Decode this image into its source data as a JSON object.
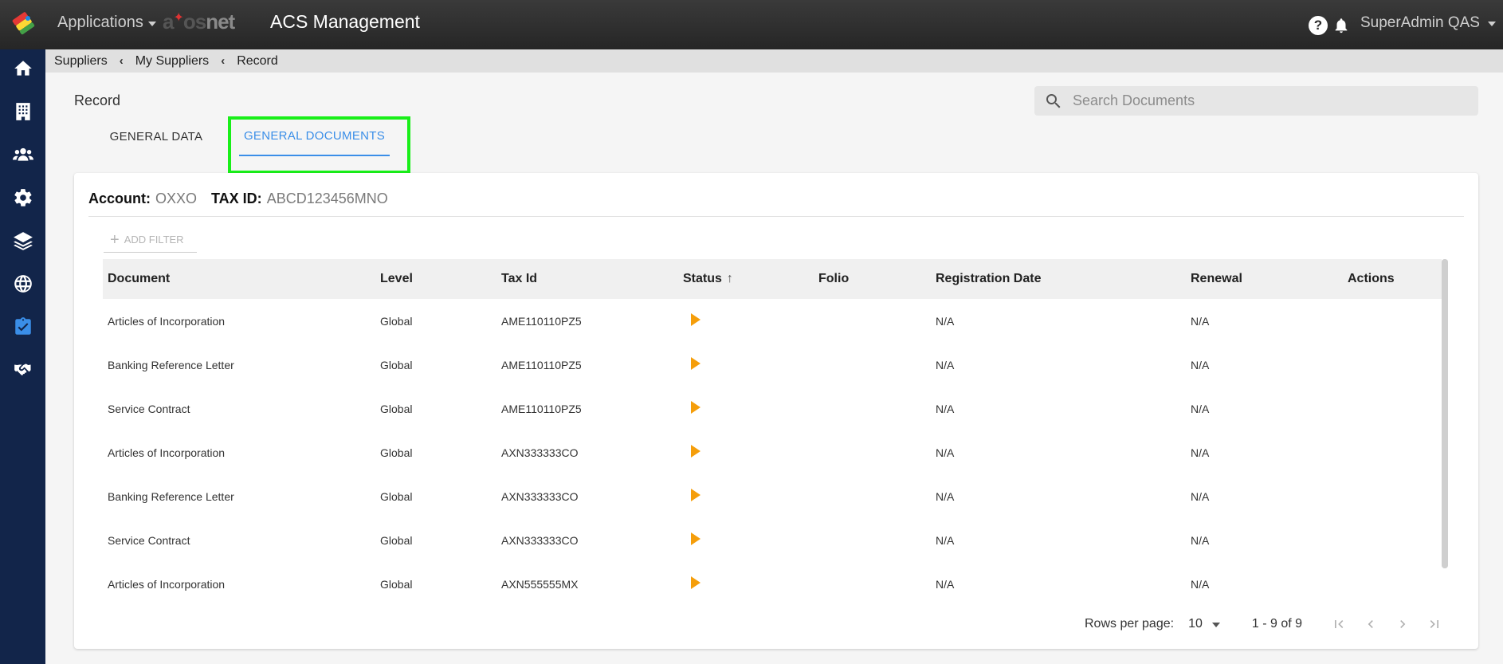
{
  "topbar": {
    "apps_label": "Applications",
    "brand_logo": "aXosnet",
    "app_title": "ACS Management",
    "user_name": "SuperAdmin QAS"
  },
  "sidebar": {
    "items": [
      {
        "icon": "home-icon"
      },
      {
        "icon": "building-icon"
      },
      {
        "icon": "users-icon"
      },
      {
        "icon": "gear-icon"
      },
      {
        "icon": "layers-icon"
      },
      {
        "icon": "globe-icon"
      },
      {
        "icon": "clipboard-check-icon",
        "active": true
      },
      {
        "icon": "handshake-icon"
      }
    ]
  },
  "breadcrumb": [
    "Suppliers",
    "My Suppliers",
    "Record"
  ],
  "page": {
    "title": "Record",
    "search_placeholder": "Search Documents"
  },
  "tabs": [
    "GENERAL DATA",
    "GENERAL DOCUMENTS"
  ],
  "account": {
    "account_label": "Account:",
    "account_value": "OXXO",
    "tax_label": "TAX ID:",
    "tax_value": "ABCD123456MNO"
  },
  "filter": {
    "add_label": "ADD FILTER"
  },
  "table": {
    "columns": [
      "Document",
      "Level",
      "Tax Id",
      "Status",
      "Folio",
      "Registration Date",
      "Renewal",
      "Actions"
    ],
    "sort": {
      "column": "Status",
      "direction": "ascending"
    },
    "rows": [
      [
        "Articles of Incorporation",
        "Global",
        "AME110110PZ5",
        "",
        "",
        "N/A",
        "N/A",
        ""
      ],
      [
        "Banking Reference Letter",
        "Global",
        "AME110110PZ5",
        "",
        "",
        "N/A",
        "N/A",
        ""
      ],
      [
        "Service Contract",
        "Global",
        "AME110110PZ5",
        "",
        "",
        "N/A",
        "N/A",
        ""
      ],
      [
        "Articles of Incorporation",
        "Global",
        "AXN333333CO",
        "",
        "",
        "N/A",
        "N/A",
        ""
      ],
      [
        "Banking Reference Letter",
        "Global",
        "AXN333333CO",
        "",
        "",
        "N/A",
        "N/A",
        ""
      ],
      [
        "Service Contract",
        "Global",
        "AXN333333CO",
        "",
        "",
        "N/A",
        "N/A",
        ""
      ],
      [
        "Articles of Incorporation",
        "Global",
        "AXN555555MX",
        "",
        "",
        "N/A",
        "N/A",
        ""
      ]
    ]
  },
  "pagination": {
    "rows_per_page_label": "Rows per page:",
    "rows_per_page_value": "10",
    "range": "1 - 9 of 9"
  },
  "colors": {
    "topbar": "#2e2e2e",
    "sidebar": "#12254a",
    "accent": "#3a8ee8",
    "status_play": "#f59e0b",
    "highlight": "#19ef19"
  }
}
